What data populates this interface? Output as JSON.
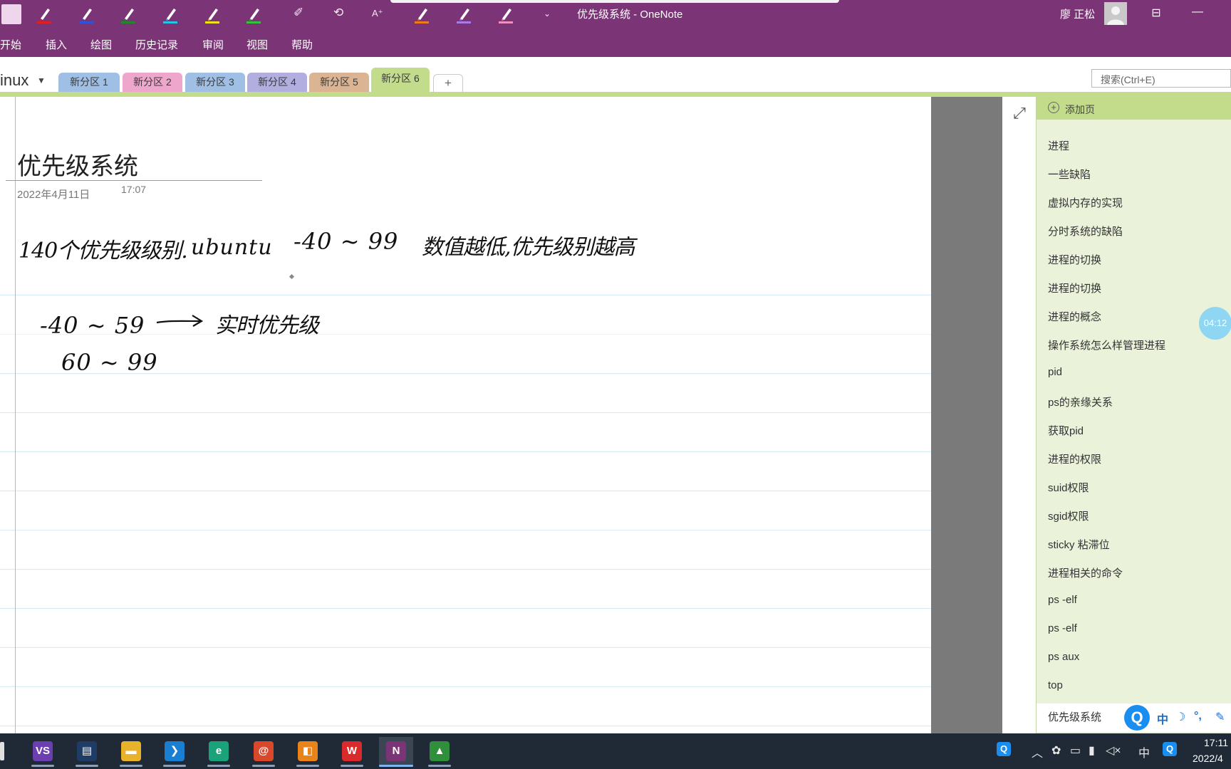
{
  "window": {
    "title": "优先级系统  -  OneNote",
    "user_name": "廖 正松",
    "restore_glyph": "⊟",
    "minimize_glyph": "—"
  },
  "draw_toolbar": {
    "pens": [
      {
        "name": "pen-light-pink",
        "color": "#f2c9ec"
      },
      {
        "name": "pen-red",
        "color": "#e02020"
      },
      {
        "name": "pen-blue",
        "color": "#2f52d6"
      },
      {
        "name": "pen-green",
        "color": "#1d8a2a"
      },
      {
        "name": "pen-cyan",
        "color": "#27c4e8"
      },
      {
        "name": "pen-yellow",
        "color": "#f2e21a"
      },
      {
        "name": "pen-lime",
        "color": "#34c23a"
      },
      {
        "name": "highlighter-orange",
        "color": "#f07b1f"
      },
      {
        "name": "highlighter-purple",
        "color": "#a97be8"
      },
      {
        "name": "highlighter-pink",
        "color": "#f28fc0"
      }
    ],
    "eraser_icon": "eraser-icon",
    "lasso_icon": "lasso-select-icon",
    "ink_to_text_icon": "ink-to-text-icon",
    "more_glyph": "⌄"
  },
  "ribbon": {
    "tabs": [
      "开始",
      "插入",
      "绘图",
      "历史记录",
      "审阅",
      "视图",
      "帮助"
    ]
  },
  "notebook": {
    "name": "inux",
    "sections": [
      {
        "label": "新分区 1",
        "color": "#9fbfe4"
      },
      {
        "label": "新分区 2",
        "color": "#efa6cd"
      },
      {
        "label": "新分区 3",
        "color": "#9fbfe4"
      },
      {
        "label": "新分区 4",
        "color": "#b2aee0"
      },
      {
        "label": "新分区 5",
        "color": "#dbb593"
      },
      {
        "label": "新分区 6",
        "color": "#c3dc8c"
      }
    ],
    "add_tab_label": "+",
    "search_placeholder": "搜索(Ctrl+E)"
  },
  "page": {
    "title": "优先级系统",
    "date": "2022年4月11日",
    "time": "17:07",
    "ink": {
      "line1_part1": "140个优先级级别.",
      "line1_part2": "ubuntu",
      "line1_part3": "-40 ~ 99",
      "line1_part4": "数值越低,优先级别越高",
      "line2_left": "-40 ~ 59",
      "line2_right": "实时优先级",
      "line3": "60 ~ 99"
    }
  },
  "pages_panel": {
    "add_page_label": "添加页",
    "items": [
      "进程",
      "一些缺陷",
      "虚拟内存的实现",
      "分时系统的缺陷",
      "进程的切换",
      "进程的切换",
      "进程的概念",
      "操作系统怎么样管理进程",
      "pid",
      "ps的亲缘关系",
      "获取pid",
      "进程的权限",
      "suid权限",
      "sgid权限",
      "sticky 粘滞位",
      "进程相关的命令",
      "ps -elf",
      "ps -elf",
      "ps aux",
      "top"
    ],
    "current_page": "优先级系统",
    "timer": "04:12"
  },
  "ime": {
    "logo": "Q",
    "mode": "中",
    "moon": "☽",
    "punct": "°,",
    "wrench": "✎"
  },
  "taskbar": {
    "apps": [
      {
        "name": "visual-studio-app",
        "glyph": "VS",
        "color": "#6b3fb0"
      },
      {
        "name": "file-manager-app",
        "glyph": "▤",
        "color": "#1e3c66"
      },
      {
        "name": "file-explorer-app",
        "glyph": "▬",
        "color": "#e8b22a"
      },
      {
        "name": "vscode-app",
        "glyph": "❯",
        "color": "#1a7fd1"
      },
      {
        "name": "edge-app",
        "glyph": "e",
        "color": "#1aa37a"
      },
      {
        "name": "snail-app",
        "glyph": "@",
        "color": "#d9482b"
      },
      {
        "name": "orange-app",
        "glyph": "◧",
        "color": "#e8841a"
      },
      {
        "name": "wps-app",
        "glyph": "W",
        "color": "#d92b2b"
      },
      {
        "name": "onenote-app",
        "glyph": "N",
        "color": "#7b3476"
      },
      {
        "name": "paint-app",
        "glyph": "▲",
        "color": "#2f8f3a"
      }
    ],
    "tray": {
      "q_label": "Q",
      "chevron": "︿",
      "lang": "中"
    },
    "clock_time": "17:11",
    "clock_date": "2022/4"
  }
}
